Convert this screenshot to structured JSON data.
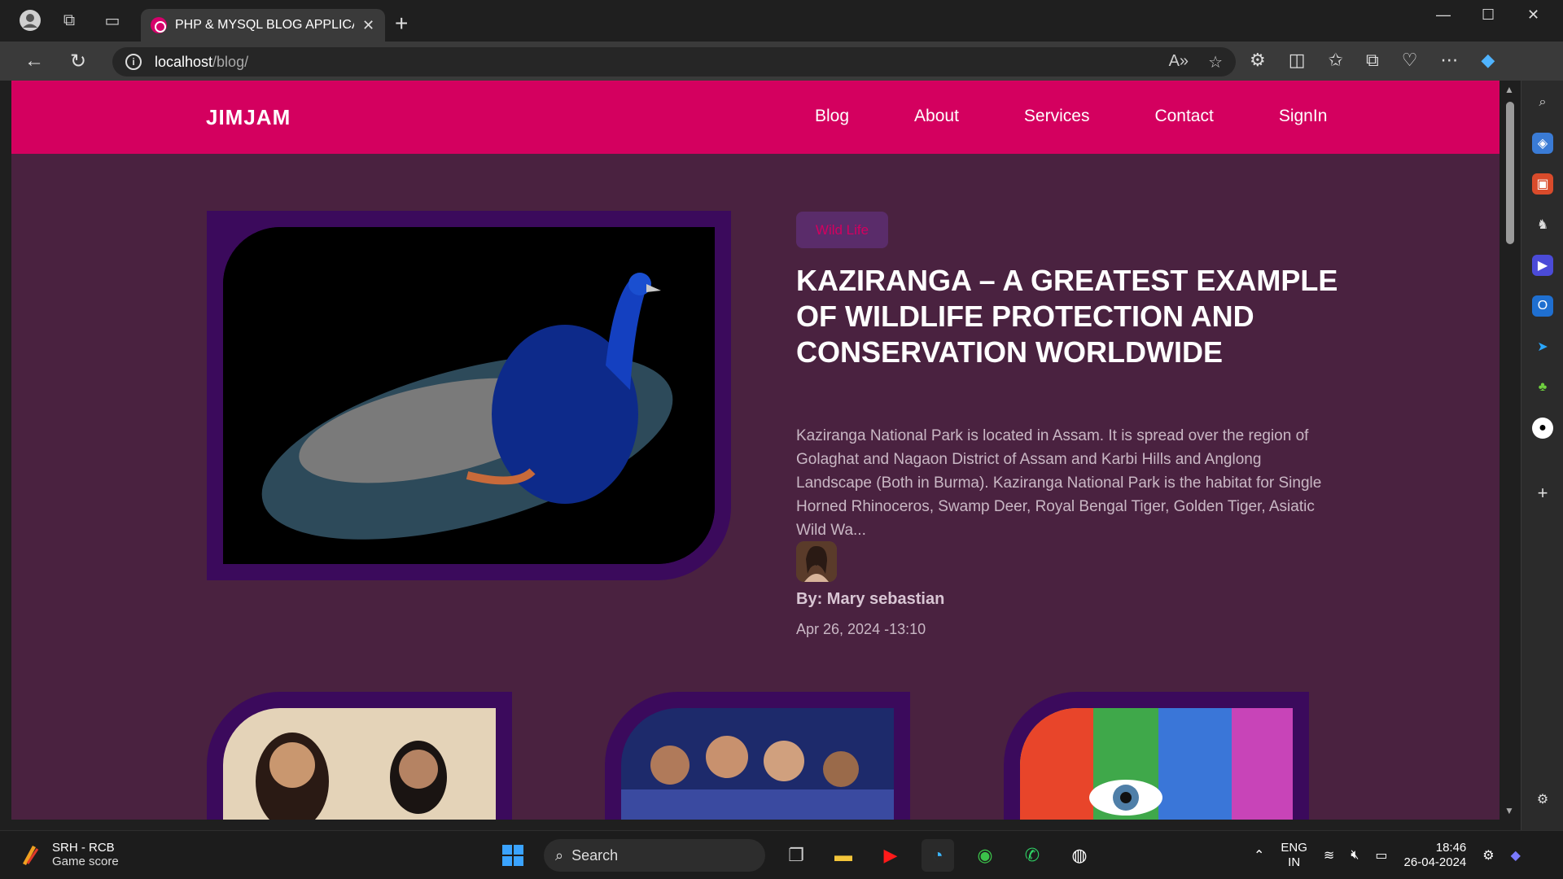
{
  "browser": {
    "tab_title": "PHP & MYSQL BLOG APPLICATIO",
    "url_host": "localhost",
    "url_path": "/blog/"
  },
  "site": {
    "logo": "JIMJAM",
    "nav": [
      "Blog",
      "About",
      "Services",
      "Contact",
      "SignIn"
    ]
  },
  "featured": {
    "category": "Wild Life",
    "headline": "KAZIRANGA – A GREATEST EXAMPLE OF WILDLIFE PROTECTION AND CONSERVATION WORLDWIDE",
    "excerpt": "Kaziranga National Park is located in Assam. It is spread over the region of Golaghat and Nagaon District of Assam and Karbi Hills and Anglong Landscape (Both in Burma). Kaziranga National Park is the habitat for Single Horned Rhinoceros, Swamp Deer, Royal Bengal Tiger, Golden Tiger, Asiatic Wild Wa...",
    "author": "By: Mary sebastian",
    "date": "Apr 26, 2024 -13:10"
  },
  "taskbar": {
    "widget_title": "SRH - RCB",
    "widget_subtitle": "Game score",
    "search_label": "Search",
    "lang_line1": "ENG",
    "lang_line2": "IN",
    "time": "18:46",
    "date": "26-04-2024"
  },
  "colors": {
    "site_nav": "#d4005f",
    "page_bg": "#4a2240",
    "frame": "#3b0a5c"
  }
}
